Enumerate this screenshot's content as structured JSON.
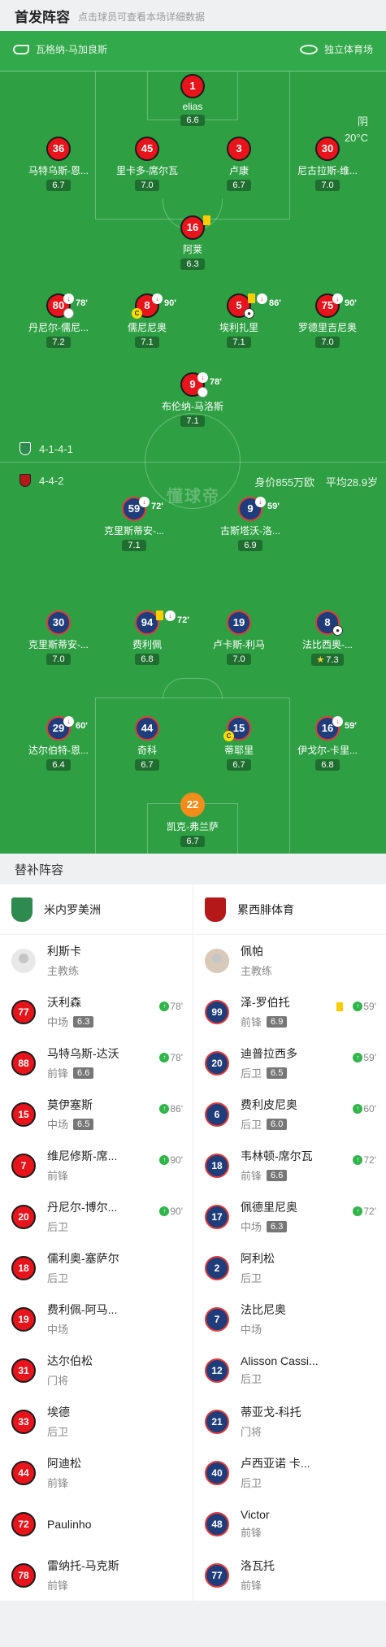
{
  "header": {
    "title": "首发阵容",
    "subtitle": "点击球员可查看本场详细数据"
  },
  "match": {
    "coach_home": "瓦格纳-马加良斯",
    "stadium": "独立体育场",
    "weather": "阴",
    "temperature": "20°C",
    "watermark": "懂球帝"
  },
  "home": {
    "formation": "4-1-4-1",
    "colors": {
      "primary": "#e8141c",
      "border": "#1a1a1a"
    },
    "players": [
      {
        "num": "1",
        "name": "elias",
        "rating": "6.6"
      },
      {
        "num": "36",
        "name": "马特乌斯-恩...",
        "rating": "6.7"
      },
      {
        "num": "45",
        "name": "里卡多-席尔瓦",
        "rating": "7.0"
      },
      {
        "num": "3",
        "name": "卢康",
        "rating": "6.7"
      },
      {
        "num": "30",
        "name": "尼古拉斯-维...",
        "rating": "7.0"
      },
      {
        "num": "16",
        "name": "阿莱",
        "rating": "6.3"
      },
      {
        "num": "80",
        "name": "丹尼尔-儒尼...",
        "rating": "7.2",
        "sub_min": "78'"
      },
      {
        "num": "8",
        "name": "儒尼尼奥",
        "rating": "7.1",
        "sub_min": "90'"
      },
      {
        "num": "5",
        "name": "埃利扎里",
        "rating": "7.1",
        "sub_min": "86'"
      },
      {
        "num": "75",
        "name": "罗德里吉尼奥",
        "rating": "7.0",
        "sub_min": "90'"
      },
      {
        "num": "9",
        "name": "布伦纳-马洛斯",
        "rating": "7.1",
        "sub_min": "78'"
      }
    ]
  },
  "away": {
    "formation": "4-4-2",
    "value": "身价855万欧",
    "avg_age": "平均28.9岁",
    "colors": {
      "primary": "#1f3d7a",
      "border": "#e33a3a"
    },
    "players": [
      {
        "num": "59",
        "name": "克里斯蒂安-...",
        "rating": "7.1",
        "sub_min": "72'"
      },
      {
        "num": "9",
        "name": "古斯塔沃-洛...",
        "rating": "6.9",
        "sub_min": "59'"
      },
      {
        "num": "30",
        "name": "克里斯蒂安-...",
        "rating": "7.0"
      },
      {
        "num": "94",
        "name": "费利佩",
        "rating": "6.8",
        "sub_min": "72'"
      },
      {
        "num": "19",
        "name": "卢卡斯-利马",
        "rating": "7.0"
      },
      {
        "num": "8",
        "name": "法比西奥-...",
        "rating": "7.3"
      },
      {
        "num": "29",
        "name": "达尔伯特-恩...",
        "rating": "6.4",
        "sub_min": "60'"
      },
      {
        "num": "44",
        "name": "奇科",
        "rating": "6.7"
      },
      {
        "num": "15",
        "name": "蒂耶里",
        "rating": "6.7"
      },
      {
        "num": "16",
        "name": "伊戈尔-卡里...",
        "rating": "6.8",
        "sub_min": "59'"
      },
      {
        "num": "22",
        "name": "凯克-弗兰萨",
        "rating": "6.7"
      }
    ]
  },
  "subs": {
    "title": "替补阵容",
    "home_team": "米内罗美洲",
    "away_team": "累西腓体育",
    "home_coach": {
      "name": "利斯卡",
      "role": "主教练"
    },
    "away_coach": {
      "name": "佩帕",
      "role": "主教练"
    },
    "home": [
      {
        "num": "77",
        "name": "沃利森",
        "pos": "中场",
        "rating": "6.3",
        "in": "78'"
      },
      {
        "num": "88",
        "name": "马特乌斯-达沃",
        "pos": "前锋",
        "rating": "6.6",
        "in": "78'"
      },
      {
        "num": "15",
        "name": "莫伊塞斯",
        "pos": "中场",
        "rating": "6.5",
        "in": "86'"
      },
      {
        "num": "7",
        "name": "维尼修斯-席...",
        "pos": "前锋",
        "rating": "",
        "in": "90'"
      },
      {
        "num": "20",
        "name": "丹尼尔-博尔...",
        "pos": "后卫",
        "rating": "",
        "in": "90'"
      },
      {
        "num": "18",
        "name": "儒利奥-塞萨尔",
        "pos": "后卫",
        "rating": "",
        "in": ""
      },
      {
        "num": "19",
        "name": "费利佩-阿马...",
        "pos": "中场",
        "rating": "",
        "in": ""
      },
      {
        "num": "31",
        "name": "达尔伯松",
        "pos": "门将",
        "rating": "",
        "in": ""
      },
      {
        "num": "33",
        "name": "埃德",
        "pos": "后卫",
        "rating": "",
        "in": ""
      },
      {
        "num": "44",
        "name": "阿迪松",
        "pos": "前锋",
        "rating": "",
        "in": ""
      },
      {
        "num": "72",
        "name": "Paulinho",
        "pos": "",
        "rating": "",
        "in": ""
      },
      {
        "num": "78",
        "name": "雷纳托-马克斯",
        "pos": "前锋",
        "rating": "",
        "in": ""
      }
    ],
    "away": [
      {
        "num": "99",
        "name": "泽-罗伯托",
        "pos": "前锋",
        "rating": "6.9",
        "in": "59'"
      },
      {
        "num": "20",
        "name": "迪普拉西多",
        "pos": "后卫",
        "rating": "6.5",
        "in": "59'"
      },
      {
        "num": "6",
        "name": "费利皮尼奥",
        "pos": "后卫",
        "rating": "6.0",
        "in": "60'"
      },
      {
        "num": "18",
        "name": "韦林顿-席尔瓦",
        "pos": "前锋",
        "rating": "6.6",
        "in": "72'"
      },
      {
        "num": "17",
        "name": "佩德里尼奥",
        "pos": "中场",
        "rating": "6.3",
        "in": "72'"
      },
      {
        "num": "2",
        "name": "阿利松",
        "pos": "后卫",
        "rating": "",
        "in": ""
      },
      {
        "num": "7",
        "name": "法比尼奥",
        "pos": "中场",
        "rating": "",
        "in": ""
      },
      {
        "num": "12",
        "name": "Alisson Cassi...",
        "pos": "后卫",
        "rating": "",
        "in": ""
      },
      {
        "num": "21",
        "name": "蒂亚戈-科托",
        "pos": "门将",
        "rating": "",
        "in": ""
      },
      {
        "num": "40",
        "name": "卢西亚诺 卡...",
        "pos": "后卫",
        "rating": "",
        "in": ""
      },
      {
        "num": "48",
        "name": "Victor",
        "pos": "前锋",
        "rating": "",
        "in": ""
      },
      {
        "num": "77",
        "name": "洛瓦托",
        "pos": "前锋",
        "rating": "",
        "in": ""
      }
    ]
  }
}
